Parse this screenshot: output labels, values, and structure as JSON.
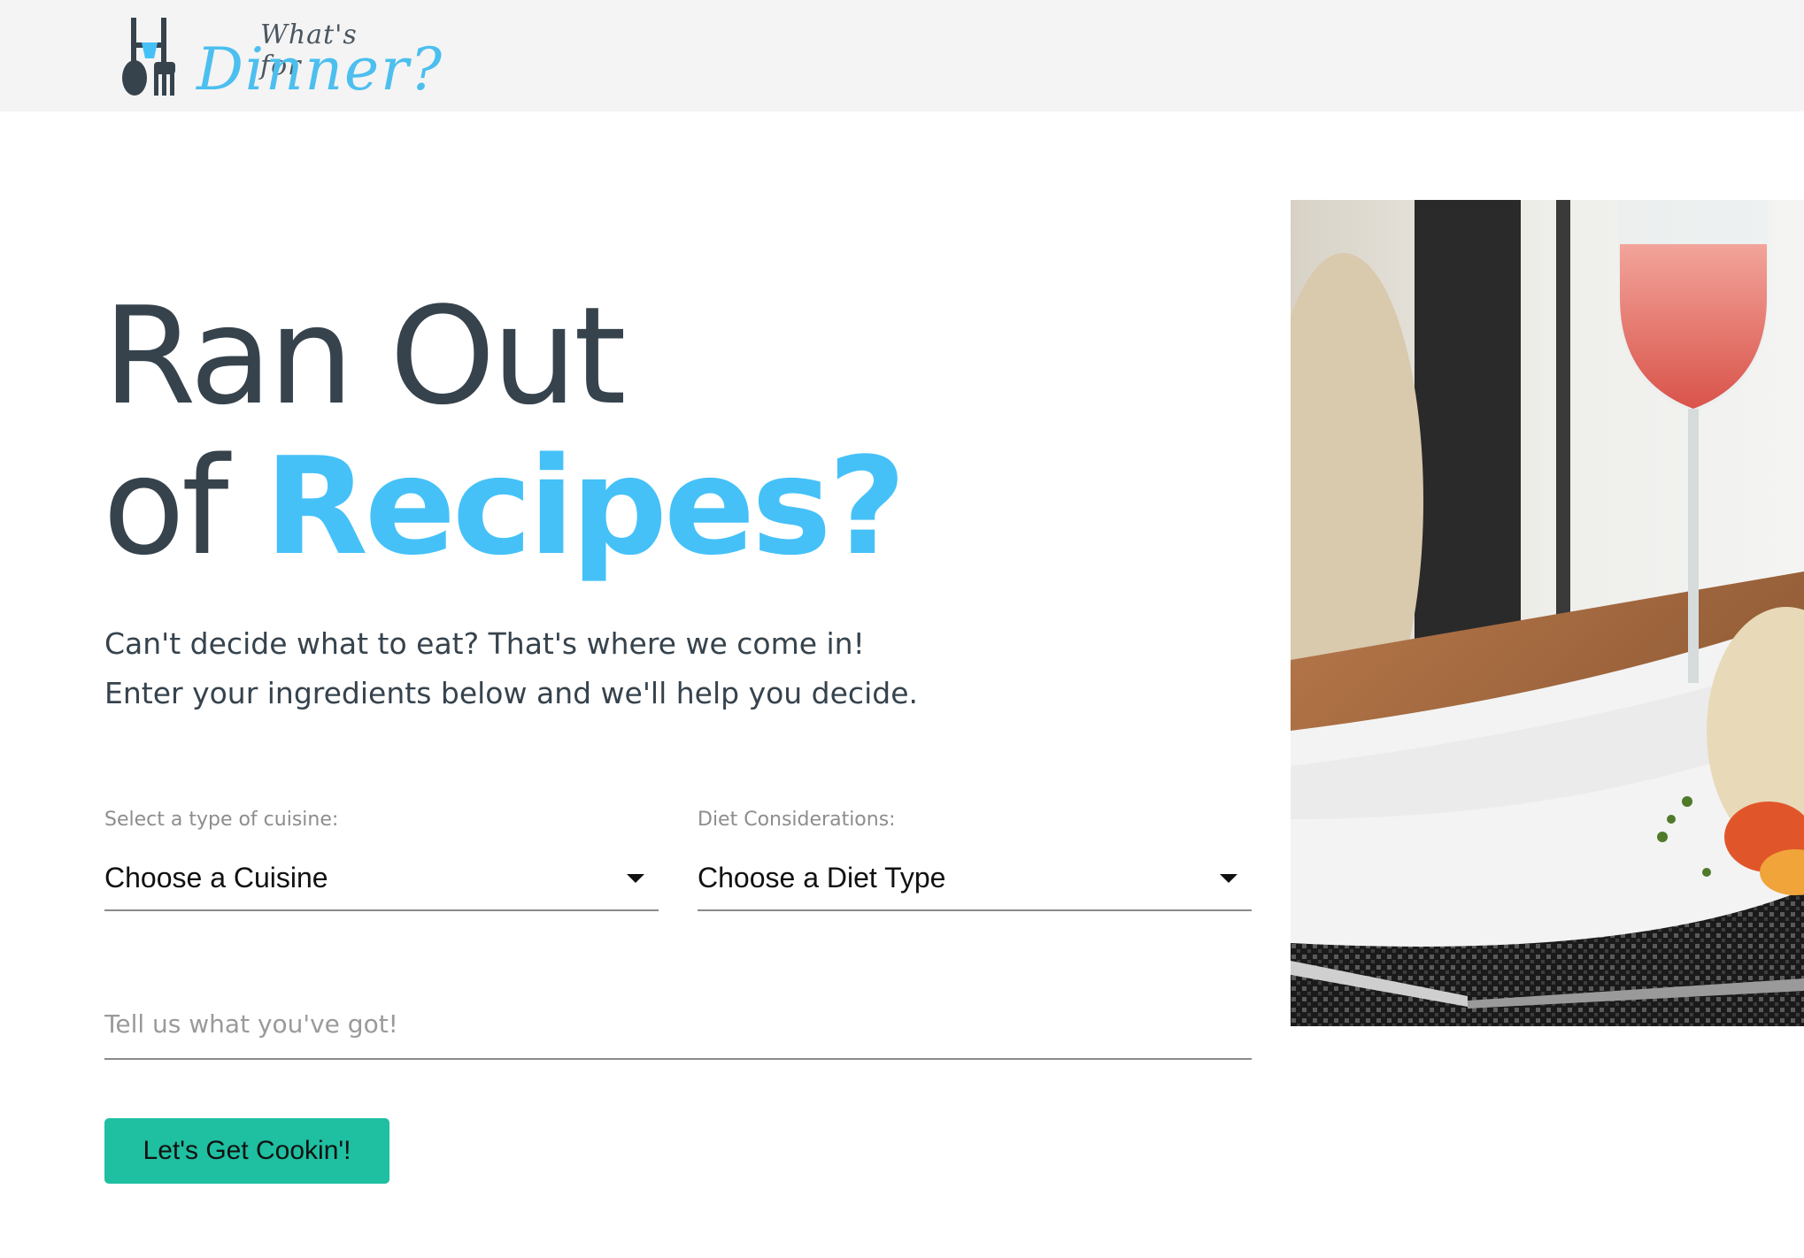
{
  "header": {
    "logo": {
      "tagline": "What's for",
      "wordmark": "Dinner?"
    }
  },
  "hero": {
    "headline_line1": "Ran Out",
    "headline_line2_prefix": "of ",
    "headline_line2_accent": "Recipes?",
    "subtitle_line1": "Can't decide what to eat? That's where we come in!",
    "subtitle_line2": "Enter your ingredients below and we'll help you decide."
  },
  "form": {
    "cuisine": {
      "label": "Select a type of cuisine:",
      "value": "Choose a Cuisine"
    },
    "diet": {
      "label": "Diet Considerations:",
      "value": "Choose a Diet Type"
    },
    "ingredients": {
      "placeholder": "Tell us what you've got!"
    },
    "submit_label": "Let's Get Cookin'!"
  },
  "colors": {
    "accent": "#45c1f8",
    "button": "#1fbfa1",
    "text_dark": "#36434d",
    "header_bg": "#f4f4f4"
  }
}
